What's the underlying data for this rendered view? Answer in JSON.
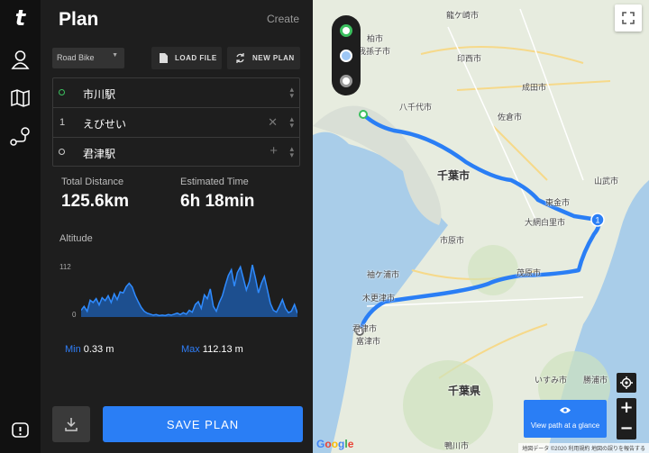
{
  "rail": {
    "logo": "t",
    "icons": [
      "user-icon",
      "map-icon",
      "route-icon",
      "feedback-icon"
    ]
  },
  "panel": {
    "title": "Plan",
    "create_label": "Create",
    "bike_type": "Road Bike",
    "load_file_label": "LOAD FILE",
    "new_plan_label": "NEW PLAN",
    "stops": [
      {
        "marker": "start",
        "label": "",
        "name": "市川駅"
      },
      {
        "marker": "waypoint",
        "label": "1",
        "name": "えびせい"
      },
      {
        "marker": "end",
        "label": "",
        "name": "君津駅"
      }
    ],
    "stats": {
      "distance_label": "Total Distance",
      "distance_value": "125.6km",
      "time_label": "Estimated Time",
      "time_value": "6h 18min"
    },
    "altitude": {
      "label": "Altitude",
      "axis_top": "112",
      "axis_bottom": "0",
      "min_label": "Min",
      "min_value": "0.33 m",
      "max_label": "Max",
      "max_value": "112.13 m"
    },
    "save_label": "SAVE PLAN"
  },
  "chart_data": {
    "type": "area",
    "ylabel": "Altitude",
    "ylim": [
      0,
      112
    ],
    "y_ticks": [
      "112",
      "0"
    ],
    "series": [
      {
        "values": [
          14,
          22,
          12,
          35,
          30,
          38,
          25,
          40,
          34,
          44,
          30,
          48,
          36,
          52,
          50,
          63,
          70,
          62,
          45,
          32,
          20,
          12,
          8,
          6,
          4,
          5,
          3,
          4,
          3,
          5,
          4,
          6,
          8,
          5,
          9,
          6,
          14,
          10,
          26,
          32,
          18,
          46,
          38,
          58,
          22,
          12,
          30,
          44,
          66,
          86,
          98,
          64,
          92,
          104,
          80,
          56,
          74,
          108,
          82,
          50,
          70,
          84,
          56,
          28,
          14,
          10,
          22,
          36,
          18,
          9,
          12,
          26,
          8
        ]
      }
    ]
  },
  "map": {
    "labels": [
      {
        "t": "柏市",
        "cls": ""
      },
      {
        "t": "我孫子市",
        "cls": ""
      },
      {
        "t": "龍ケ崎市",
        "cls": ""
      },
      {
        "t": "印西市",
        "cls": ""
      },
      {
        "t": "成田市",
        "cls": ""
      },
      {
        "t": "佐倉市",
        "cls": ""
      },
      {
        "t": "八千代市",
        "cls": ""
      },
      {
        "t": "千葉市",
        "cls": "big"
      },
      {
        "t": "東金市",
        "cls": ""
      },
      {
        "t": "大網白里市",
        "cls": ""
      },
      {
        "t": "市原市",
        "cls": ""
      },
      {
        "t": "袖ケ浦市",
        "cls": ""
      },
      {
        "t": "木更津市",
        "cls": ""
      },
      {
        "t": "茂原市",
        "cls": ""
      },
      {
        "t": "富津市",
        "cls": ""
      },
      {
        "t": "千葉県",
        "cls": "big"
      },
      {
        "t": "鴨川市",
        "cls": ""
      },
      {
        "t": "山武市",
        "cls": ""
      },
      {
        "t": "君津市",
        "cls": ""
      },
      {
        "t": "いすみ市",
        "cls": ""
      },
      {
        "t": "勝浦市",
        "cls": ""
      }
    ],
    "route_color": "#2a7ef5",
    "waypoint_label": "1",
    "glance_label": "View path at a glance",
    "zoom_in": "+",
    "zoom_out": "−",
    "google": "Google",
    "attribution": "地図データ ©2020   利用規約   地図の誤りを報告する"
  }
}
